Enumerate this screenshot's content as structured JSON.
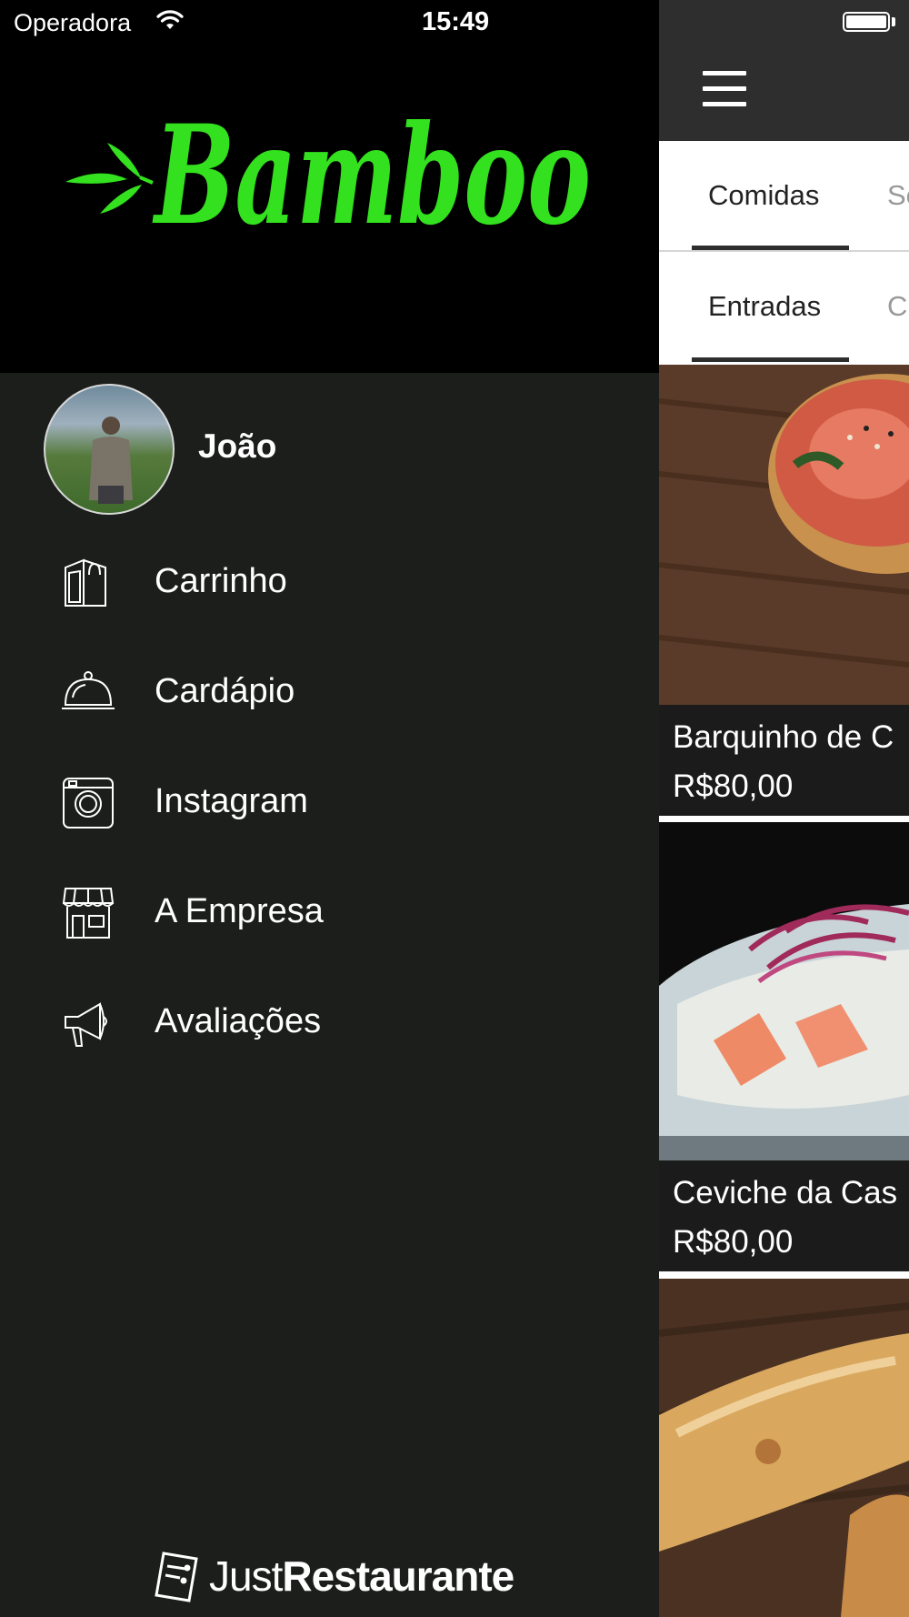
{
  "status_bar": {
    "carrier": "Operadora",
    "time": "15:49"
  },
  "brand": {
    "logo_text": "Bamboo",
    "logo_color": "#33e11e"
  },
  "user": {
    "name": "João"
  },
  "menu": {
    "items": [
      {
        "label": "Carrinho",
        "icon": "shopping-bag-icon"
      },
      {
        "label": "Cardápio",
        "icon": "cloche-icon"
      },
      {
        "label": "Instagram",
        "icon": "instagram-icon"
      },
      {
        "label": "A Empresa",
        "icon": "storefront-icon"
      },
      {
        "label": "Avaliações",
        "icon": "megaphone-icon"
      }
    ]
  },
  "footer": {
    "brand_light": "Just",
    "brand_bold": "Restaurante"
  },
  "content": {
    "category_tabs": [
      {
        "label": "Comidas"
      },
      {
        "label": "Se"
      }
    ],
    "subcategory_tabs": [
      {
        "label": "Entradas"
      },
      {
        "label": "C"
      }
    ],
    "items": [
      {
        "title": "Barquinho de C",
        "price": "R$80,00"
      },
      {
        "title": "Ceviche da Cas",
        "price": "R$80,00"
      }
    ]
  }
}
